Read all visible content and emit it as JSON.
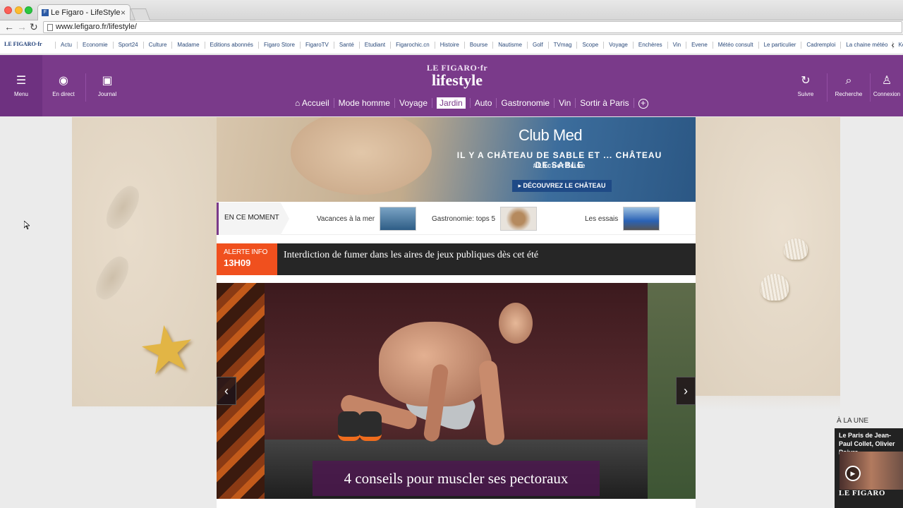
{
  "browser": {
    "tab_title": "Le Figaro - LifeStyle",
    "url": "www.lefigaro.fr/lifestyle/"
  },
  "bookmarks": {
    "logo": "LE FIGARO·fr",
    "items": [
      "Actu",
      "Economie",
      "Sport24",
      "Culture",
      "Madame",
      "Editions abonnés",
      "Figaro Store",
      "FigaroTV",
      "Santé",
      "Etudiant",
      "Figarochic.cn",
      "Histoire",
      "Bourse",
      "Nautisme",
      "Golf",
      "TVmag",
      "Scope",
      "Voyage",
      "Enchères",
      "Vin",
      "Evene",
      "Météo consult",
      "Le particulier",
      "Cadremploi",
      "La chaine météo",
      "Keljob",
      "Ke"
    ]
  },
  "header": {
    "menu": "Menu",
    "en_direct": "En direct",
    "journal": "Journal",
    "logo_top": "LE FIGARO·fr",
    "logo_main": "lifestyle",
    "suivre": "Suivre",
    "recherche": "Recherche",
    "connexion": "Connexion",
    "nav": [
      "Accueil",
      "Mode homme",
      "Voyage",
      "Jardin",
      "Auto",
      "Gastronomie",
      "Vin",
      "Sortir à Paris"
    ],
    "active_nav": "Jardin"
  },
  "ad": {
    "brand": "Club Med",
    "line1": "IL Y A CHÂTEAU DE SABLE ET ... CHÂTEAU DE SABLE",
    "line2": "#LâcherPrise",
    "cta": "DÉCOUVREZ LE CHÂTEAU"
  },
  "en_ce_moment": {
    "label": "EN CE MOMENT",
    "items": [
      {
        "label": "Vacances à la mer"
      },
      {
        "label": "Gastronomie: tops 5"
      },
      {
        "label": "Les essais"
      }
    ]
  },
  "alert": {
    "tag": "ALERTE INFO",
    "time": "13H09",
    "text": "Interdiction de fumer dans les aires de jeux publiques dès cet été"
  },
  "hero": {
    "caption": "4 conseils pour muscler ses pectoraux",
    "prev": "‹",
    "next": "›"
  },
  "a_la_une": {
    "label": "À LA UNE",
    "title": "Le Paris de Jean-Paul Collet, Olivier Poivre",
    "brand": "LE FIGARO"
  },
  "colors": {
    "header_purple": "#7a3a8a",
    "alert_orange": "#f0501e",
    "ad_cta_blue": "#1f4a86"
  }
}
